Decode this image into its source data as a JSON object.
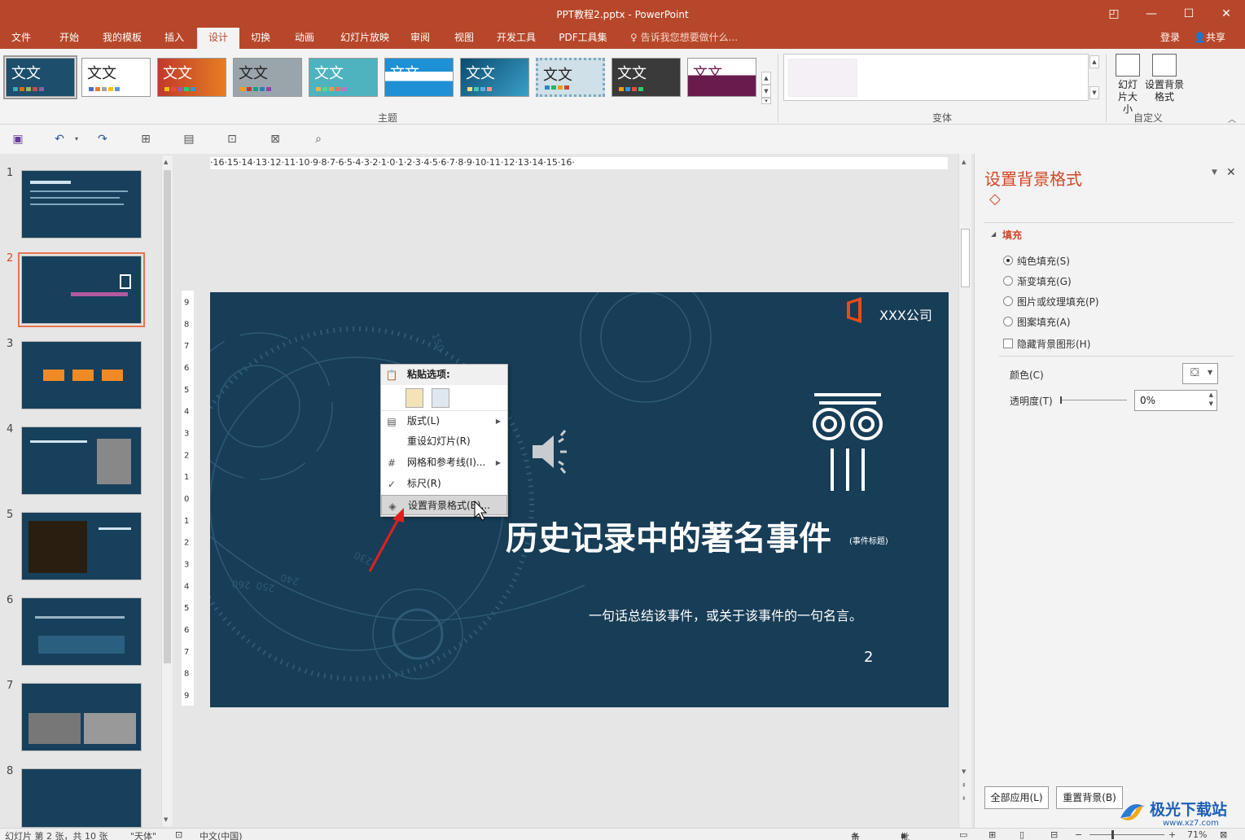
{
  "window": {
    "title": "PPT教程2.pptx - PowerPoint"
  },
  "tabs": [
    "文件",
    "开始",
    "我的模板",
    "插入",
    "设计",
    "切换",
    "动画",
    "幻灯片放映",
    "审阅",
    "视图",
    "开发工具",
    "PDF工具集"
  ],
  "active_tab": "设计",
  "tell_me": "告诉我您想要做什么...",
  "login": "登录",
  "share": "共享",
  "ribbon": {
    "theme_tile_text": "文文",
    "themes_group": "主题",
    "variants_group": "变体",
    "customize_group": "自定义",
    "slide_size": "幻灯片大小",
    "format_bg": "设置背景格式"
  },
  "slide_numbers": [
    "1",
    "2",
    "3",
    "4",
    "5",
    "6",
    "7",
    "8"
  ],
  "active_slide": "2",
  "ruler": {
    "horizontal": "·16·15·14·13·12·11·10·9·8·7·6·5·4·3·2·1·0·1·2·3·4·5·6·7·8·9·10·11·12·13·14·15·16·",
    "vertical": [
      "9",
      "8",
      "7",
      "6",
      "5",
      "4",
      "3",
      "2",
      "1",
      "0",
      "1",
      "2",
      "3",
      "4",
      "5",
      "6",
      "7",
      "8",
      "9"
    ]
  },
  "slide": {
    "company": "XXX公司",
    "title": "历史记录中的著名事件",
    "title_note": "(事件标题)",
    "subtitle": "一句话总结该事件，或关于该事件的一句名言。",
    "page_number": "2",
    "dial_numbers": [
      "150",
      "240",
      "250",
      "260",
      "230"
    ]
  },
  "context_menu": {
    "paste_header": "粘贴选项:",
    "layout": "版式(L)",
    "reset": "重设幻灯片(R)",
    "grid": "网格和参考线(I)...",
    "ruler": "标尺(R)",
    "format_bg": "设置背景格式(B)..."
  },
  "format_pane": {
    "title": "设置背景格式",
    "section": "填充",
    "options": [
      "纯色填充(S)",
      "渐变填充(G)",
      "图片或纹理填充(P)",
      "图案填充(A)"
    ],
    "selected_option": "纯色填充(S)",
    "hide_bg": "隐藏背景图形(H)",
    "color_label": "颜色(C)",
    "transparency_label": "透明度(T)",
    "transparency_value": "0%",
    "apply_all": "全部应用(L)",
    "reset_bg": "重置背景(B)"
  },
  "status": {
    "slide_info": "幻灯片 第 2 张，共 10 张",
    "theme": "\"天体\"",
    "language": "中文(中国)",
    "notes": "备注",
    "comments": "批注",
    "zoom": "71%"
  },
  "watermark": {
    "brand": "极光下载站",
    "url": "www.xz7.com"
  },
  "colors": {
    "accent": "#b7472a",
    "slide_bg": "#173d57",
    "pane_title": "#d24726"
  }
}
